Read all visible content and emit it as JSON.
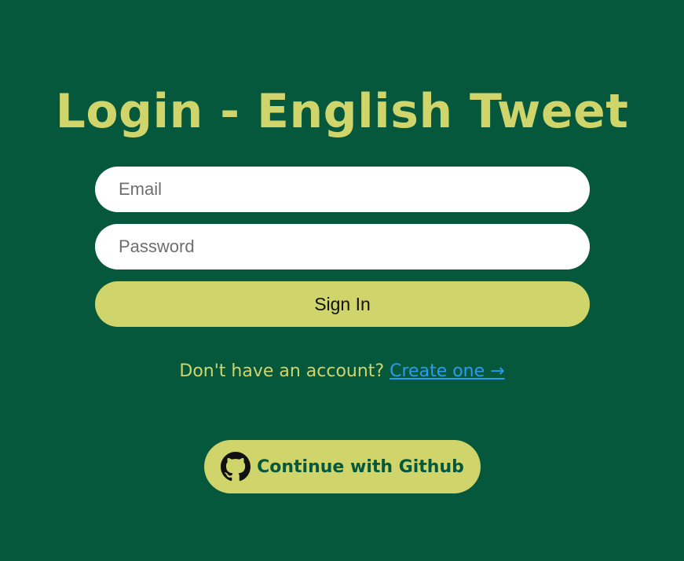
{
  "page": {
    "title": "Login - English Tweet"
  },
  "form": {
    "email": {
      "placeholder": "Email",
      "value": ""
    },
    "password": {
      "placeholder": "Password",
      "value": ""
    },
    "submit_label": "Sign In"
  },
  "switch": {
    "prompt": "Don't have an account?",
    "link_label": "Create one →"
  },
  "github": {
    "label": "Continue with Github",
    "icon": "github-icon"
  },
  "colors": {
    "background": "#06583c",
    "accent": "#cfd56b",
    "link": "#2b9bf0",
    "input_bg": "#ffffff"
  }
}
